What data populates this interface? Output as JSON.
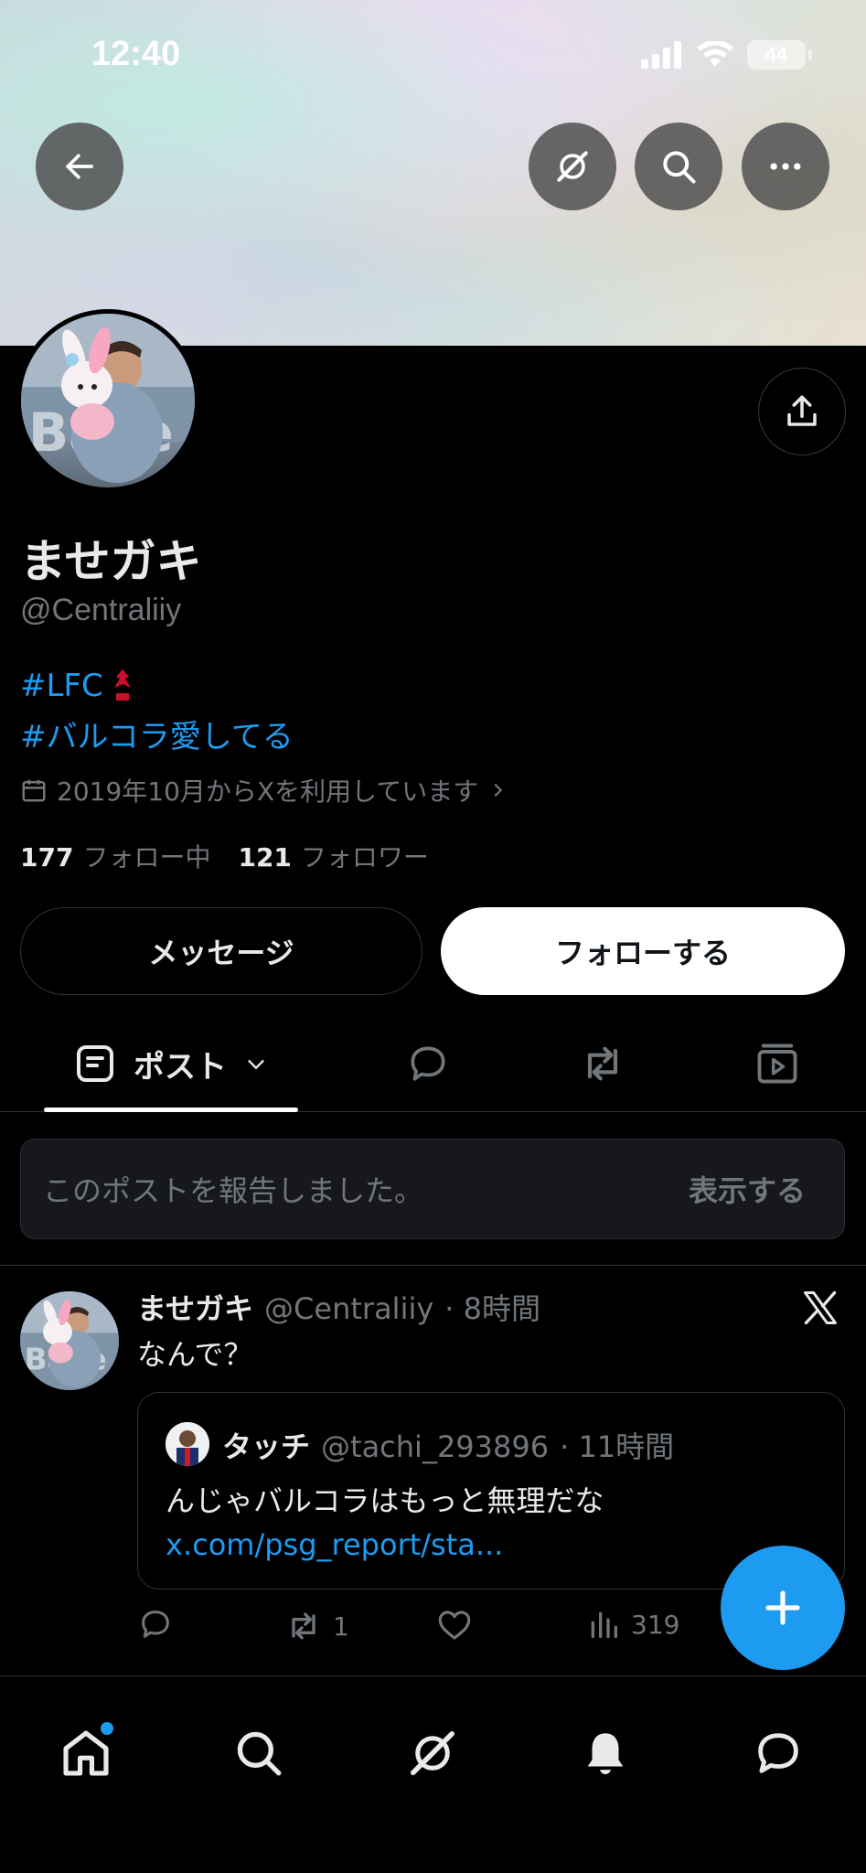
{
  "status_bar": {
    "time": "12:40",
    "battery": "44"
  },
  "profile": {
    "display_name": "ませガキ",
    "handle": "@Centraliiy",
    "bio_line1": "#LFC",
    "bio_line2": "#バルコラ愛してる",
    "joined": "2019年10月からXを利用しています",
    "following_count": "177",
    "following_label": "フォロー中",
    "followers_count": "121",
    "followers_label": "フォロワー",
    "message_button": "メッセージ",
    "follow_button": "フォローする"
  },
  "tabs": {
    "posts_label": "ポスト"
  },
  "report": {
    "text": "このポストを報告しました。",
    "show_label": "表示する"
  },
  "tweet": {
    "name": "ませガキ",
    "handle": "@Centraliiy",
    "time": "· 8時間",
    "text": "なんで？",
    "quote": {
      "name": "タッチ",
      "handle": "@tachi_293896",
      "time": "· 11時間",
      "text": "んじゃバルコラはもっと無理だな ",
      "link": "x.com/psg_report/sta..."
    },
    "actions": {
      "retweets": "1",
      "views": "319"
    }
  },
  "colors": {
    "accent": "#1d9bf0",
    "background": "#000000",
    "secondary_text": "#71767b"
  }
}
